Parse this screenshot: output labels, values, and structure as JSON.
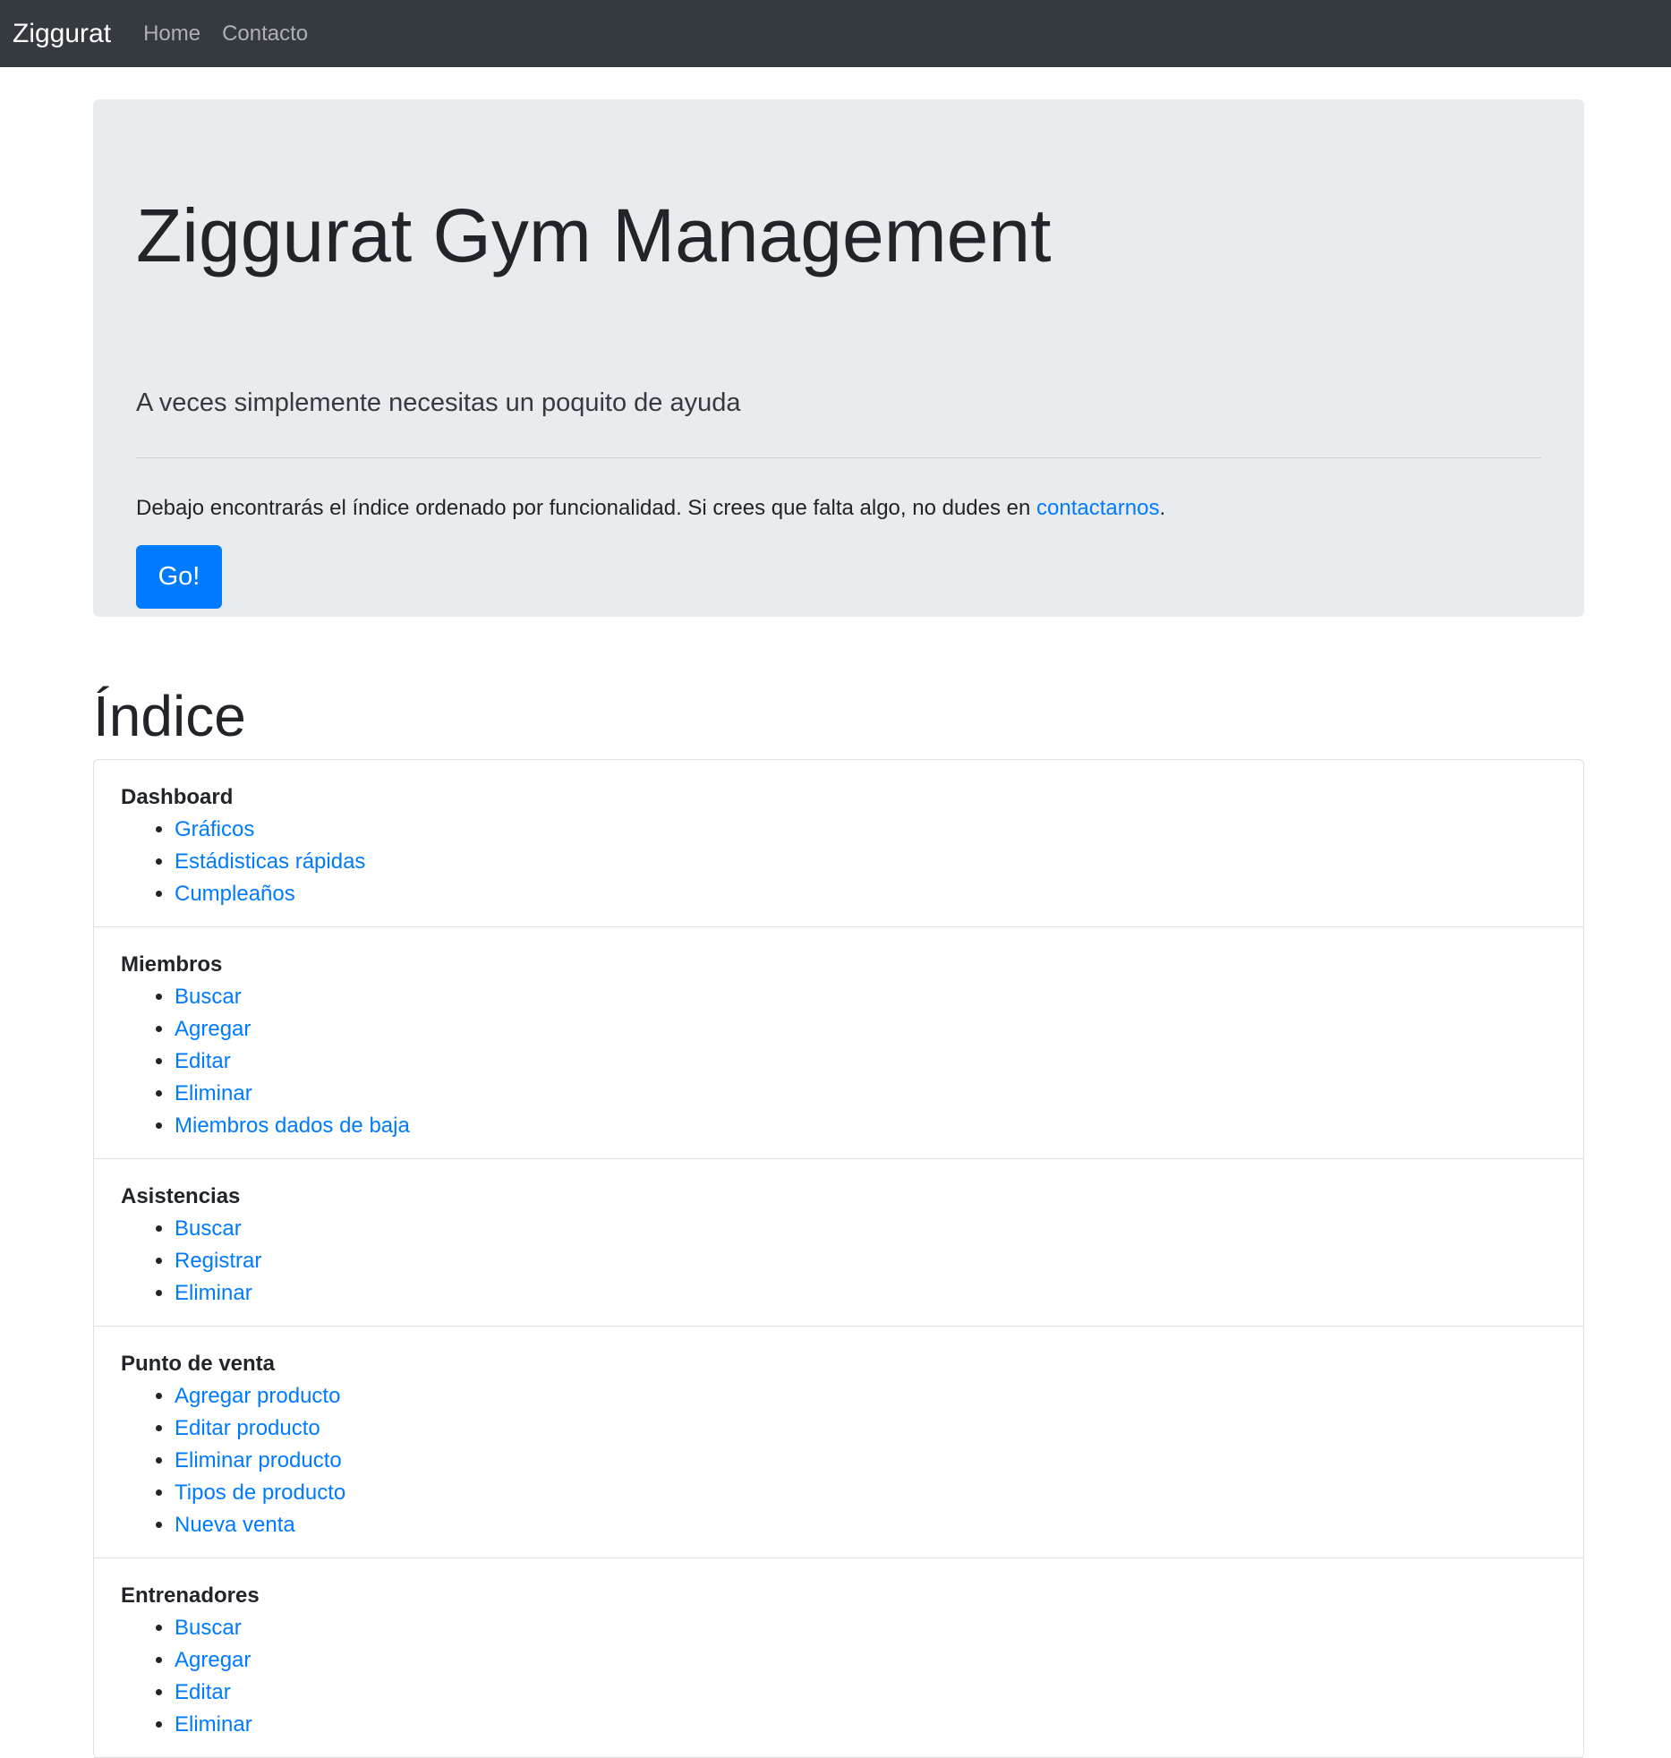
{
  "navbar": {
    "brand": "Ziggurat",
    "links": [
      "Home",
      "Contacto"
    ]
  },
  "jumbotron": {
    "title": "Ziggurat Gym Management",
    "lead": "A veces simplemente necesitas un poquito de ayuda",
    "text_before_link": "Debajo encontrarás el índice ordenado por funcionalidad. Si crees que falta algo, no dudes en ",
    "link_text": "contactarnos",
    "text_after_link": ".",
    "button_label": "Go!"
  },
  "index": {
    "title": "Índice",
    "sections": [
      {
        "title": "Dashboard",
        "items": [
          "Gráficos",
          "Estádisticas rápidas",
          "Cumpleaños"
        ]
      },
      {
        "title": "Miembros",
        "items": [
          "Buscar",
          "Agregar",
          "Editar",
          "Eliminar",
          "Miembros dados de baja"
        ]
      },
      {
        "title": "Asistencias",
        "items": [
          "Buscar",
          "Registrar",
          "Eliminar"
        ]
      },
      {
        "title": "Punto de venta",
        "items": [
          "Agregar producto",
          "Editar producto",
          "Eliminar producto",
          "Tipos de producto",
          "Nueva venta"
        ]
      },
      {
        "title": "Entrenadores",
        "items": [
          "Buscar",
          "Agregar",
          "Editar",
          "Eliminar"
        ]
      }
    ]
  },
  "colors": {
    "navbar_bg": "#343a40",
    "jumbotron_bg": "#e9ecef",
    "primary": "#007bff"
  }
}
